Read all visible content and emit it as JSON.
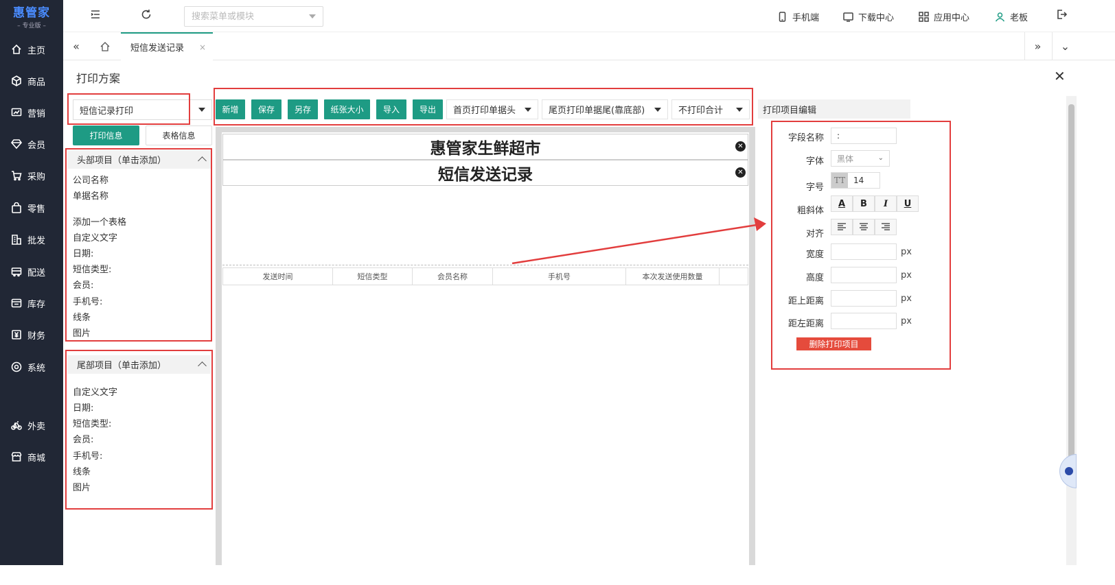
{
  "app": {
    "logo_name": "惠管家",
    "logo_edition": "– 专业版 –"
  },
  "sidebar": {
    "items": [
      {
        "label": "主页",
        "icon": "home-icon"
      },
      {
        "label": "商品",
        "icon": "cube-icon"
      },
      {
        "label": "营销",
        "icon": "chart-icon"
      },
      {
        "label": "会员",
        "icon": "diamond-icon"
      },
      {
        "label": "采购",
        "icon": "cart-icon"
      },
      {
        "label": "零售",
        "icon": "bag-icon"
      },
      {
        "label": "批发",
        "icon": "building-icon"
      },
      {
        "label": "配送",
        "icon": "truck-icon"
      },
      {
        "label": "库存",
        "icon": "warehouse-icon"
      },
      {
        "label": "财务",
        "icon": "finance-icon"
      },
      {
        "label": "系统",
        "icon": "settings-icon"
      },
      {
        "label": "外卖",
        "icon": "bike-icon"
      },
      {
        "label": "商城",
        "icon": "store-icon"
      }
    ]
  },
  "topbar": {
    "search_placeholder": "搜索菜单或模块",
    "mobile": "手机端",
    "download": "下载中心",
    "apps": "应用中心",
    "user": "老板"
  },
  "tabs": {
    "active": "短信发送记录",
    "close": "×"
  },
  "print": {
    "title": "打印方案",
    "close": "✕",
    "scheme_value": "短信记录打印",
    "tab_print_info": "打印信息",
    "tab_table_info": "表格信息",
    "header_panel": {
      "title": "头部项目（单击添加）",
      "items": [
        "公司名称",
        "单据名称",
        "添加一个表格",
        "自定义文字",
        "日期:",
        "短信类型:",
        "会员:",
        "手机号:",
        "线条",
        "图片"
      ]
    },
    "footer_panel": {
      "title": "尾部项目（单击添加）",
      "items": [
        "自定义文字",
        "日期:",
        "短信类型:",
        "会员:",
        "手机号:",
        "线条",
        "图片"
      ]
    },
    "toolbar": {
      "add": "新增",
      "save": "保存",
      "save_as": "另存",
      "paper_size": "纸张大小",
      "import": "导入",
      "export": "导出",
      "first_page_header": "首页打印单据头",
      "last_page_footer": "尾页打印单据尾(靠底部)",
      "totals": "不打印合计"
    },
    "canvas": {
      "company": "惠管家生鲜超市",
      "doc_name": "短信发送记录",
      "columns": [
        "发送时间",
        "短信类型",
        "会员名称",
        "手机号",
        "本次发送使用数量"
      ]
    },
    "editor": {
      "title": "打印项目编辑",
      "field_name_label": "字段名称",
      "field_name_value": ":",
      "font_label": "字体",
      "font_value": "黑体",
      "size_label": "字号",
      "size_value": "14",
      "size_icon_text": "TT",
      "style_label": "粗斜体",
      "style_buttons": [
        "A",
        "B",
        "I",
        "U"
      ],
      "align_label": "对齐",
      "width_label": "宽度",
      "height_label": "高度",
      "top_label": "距上距离",
      "left_label": "距左距离",
      "unit": "px",
      "delete": "删除打印项目"
    }
  },
  "colors": {
    "accent": "#1e9b84",
    "sidebar": "#212735",
    "highlight": "#e23d3d",
    "danger": "#e54b3c"
  }
}
